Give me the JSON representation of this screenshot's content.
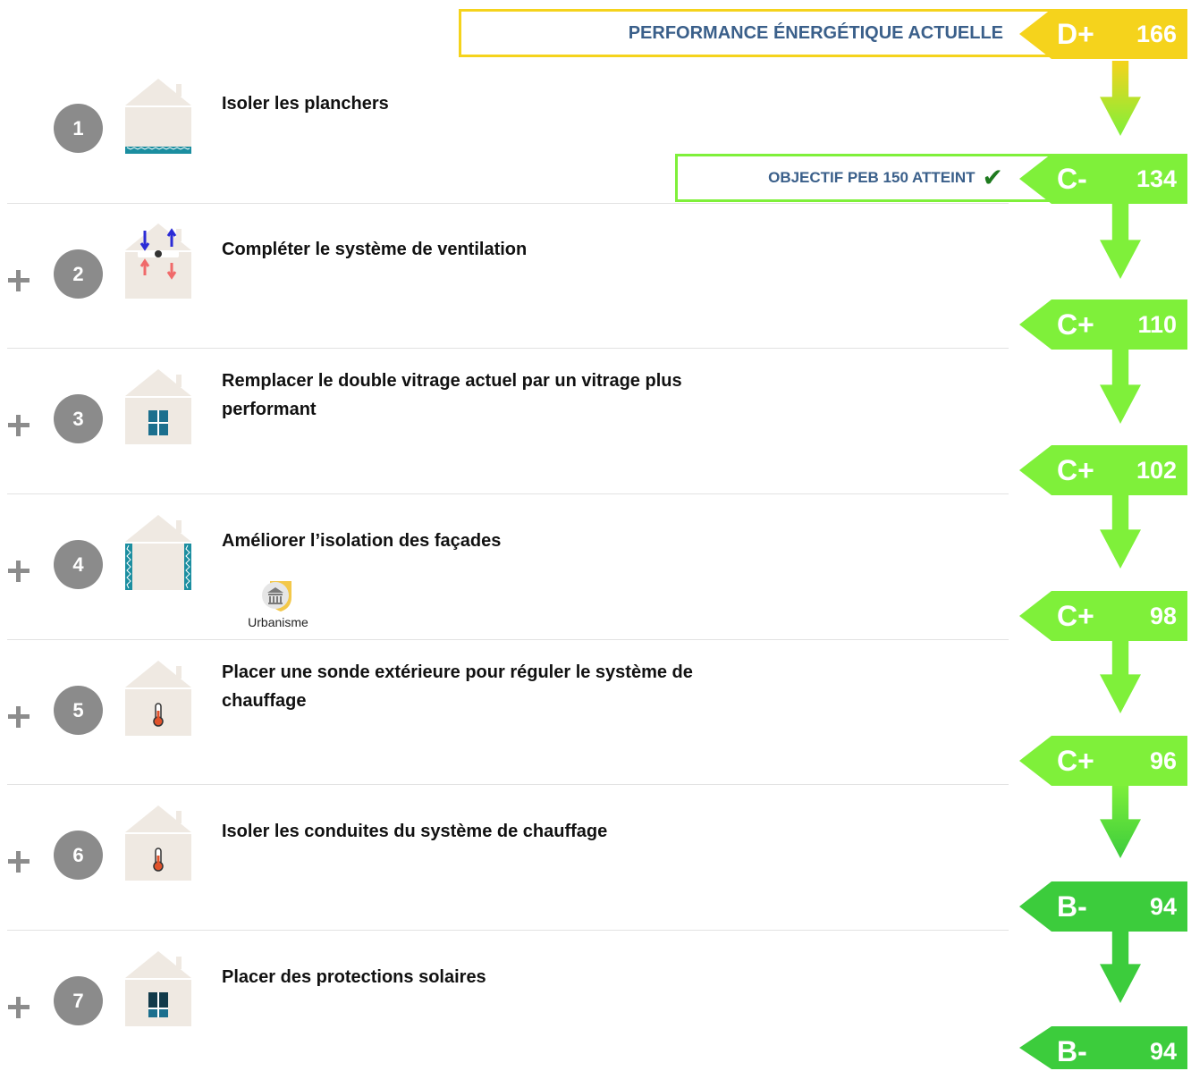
{
  "header": {
    "current_label": "PERFORMANCE ÉNERGÉTIQUE ACTUELLE",
    "current_class": "D+",
    "current_value": "166",
    "current_color": "#f5d31c"
  },
  "goal": {
    "label": "OBJECTIF PEB 150 ATTEINT",
    "check": "✔",
    "border_color": "#7ff03a"
  },
  "results": [
    {
      "class": "C-",
      "value": "134",
      "color": "#7ff03a"
    },
    {
      "class": "C+",
      "value": "110",
      "color": "#7ff03a"
    },
    {
      "class": "C+",
      "value": "102",
      "color": "#7ff03a"
    },
    {
      "class": "C+",
      "value": "98",
      "color": "#7ff03a"
    },
    {
      "class": "C+",
      "value": "96",
      "color": "#7ff03a"
    },
    {
      "class": "B-",
      "value": "94",
      "color": "#3ccc3c"
    },
    {
      "class": "B-",
      "value": "94",
      "color": "#3ccc3c"
    }
  ],
  "steps": [
    {
      "number": "1",
      "title": "Isoler les planchers",
      "icon": "house-floor-insulation-icon"
    },
    {
      "number": "2",
      "title": "Compléter le système de ventilation",
      "icon": "house-ventilation-icon"
    },
    {
      "number": "3",
      "title": "Remplacer le double vitrage actuel par un vitrage plus performant",
      "icon": "house-window-icon"
    },
    {
      "number": "4",
      "title": "Améliorer l’isolation des façades",
      "icon": "house-facade-insulation-icon",
      "badge": "Urbanisme"
    },
    {
      "number": "5",
      "title": "Placer une sonde extérieure pour réguler le système de chauffage",
      "icon": "house-thermometer-icon"
    },
    {
      "number": "6",
      "title": "Isoler les conduites du système de chauffage",
      "icon": "house-thermometer-icon"
    },
    {
      "number": "7",
      "title": "Placer des protections solaires",
      "icon": "house-sun-protection-icon"
    }
  ]
}
